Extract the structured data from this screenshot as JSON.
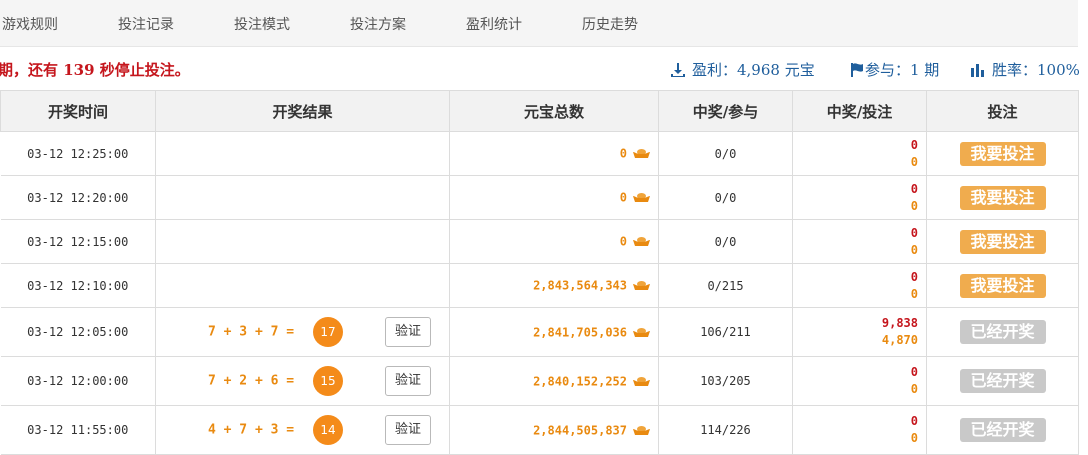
{
  "nav": [
    {
      "label": "游戏规则"
    },
    {
      "label": "投注记录"
    },
    {
      "label": "投注模式"
    },
    {
      "label": "投注方案"
    },
    {
      "label": "盈利统计"
    },
    {
      "label": "历史走势"
    }
  ],
  "info": {
    "notice": "期，还有 139 秒停止投注。",
    "profit": "盈利：4,968 元宝",
    "participate": "参与：1 期",
    "winrate": "胜率：100%"
  },
  "headers": [
    "开奖时间",
    "开奖结果",
    "元宝总数",
    "中奖/参与",
    "中奖/投注",
    "投注"
  ],
  "rows": [
    {
      "time": "03-12 12:25:00",
      "formula": "",
      "sum": "",
      "verify": "",
      "total": "0",
      "ratio": "0/0",
      "win": "0",
      "bet": "0",
      "action": "我要投注",
      "open": true
    },
    {
      "time": "03-12 12:20:00",
      "formula": "",
      "sum": "",
      "verify": "",
      "total": "0",
      "ratio": "0/0",
      "win": "0",
      "bet": "0",
      "action": "我要投注",
      "open": true
    },
    {
      "time": "03-12 12:15:00",
      "formula": "",
      "sum": "",
      "verify": "",
      "total": "0",
      "ratio": "0/0",
      "win": "0",
      "bet": "0",
      "action": "我要投注",
      "open": true
    },
    {
      "time": "03-12 12:10:00",
      "formula": "",
      "sum": "",
      "verify": "",
      "total": "2,843,564,343",
      "ratio": "0/215",
      "win": "0",
      "bet": "0",
      "action": "我要投注",
      "open": true
    },
    {
      "time": "03-12 12:05:00",
      "formula": "7 + 3 + 7 =",
      "sum": "17",
      "verify": "验证",
      "total": "2,841,705,036",
      "ratio": "106/211",
      "win": "9,838",
      "bet": "4,870",
      "action": "已经开奖",
      "open": false
    },
    {
      "time": "03-12 12:00:00",
      "formula": "7 + 2 + 6 =",
      "sum": "15",
      "verify": "验证",
      "total": "2,840,152,252",
      "ratio": "103/205",
      "win": "0",
      "bet": "0",
      "action": "已经开奖",
      "open": false
    },
    {
      "time": "03-12 11:55:00",
      "formula": "4 + 7 + 3 =",
      "sum": "14",
      "verify": "验证",
      "total": "2,844,505,837",
      "ratio": "114/226",
      "win": "0",
      "bet": "0",
      "action": "已经开奖",
      "open": false
    }
  ],
  "colors": {
    "accent": "#f0ac4e",
    "ball": "#f48b1a",
    "red": "#c5161d",
    "blue": "#1f5e9c",
    "disabled": "#c9c9c9"
  },
  "icons": {
    "profit": "download-icon",
    "participate": "flag-icon",
    "winrate": "bar-chart-icon",
    "total": "ingot-icon"
  }
}
